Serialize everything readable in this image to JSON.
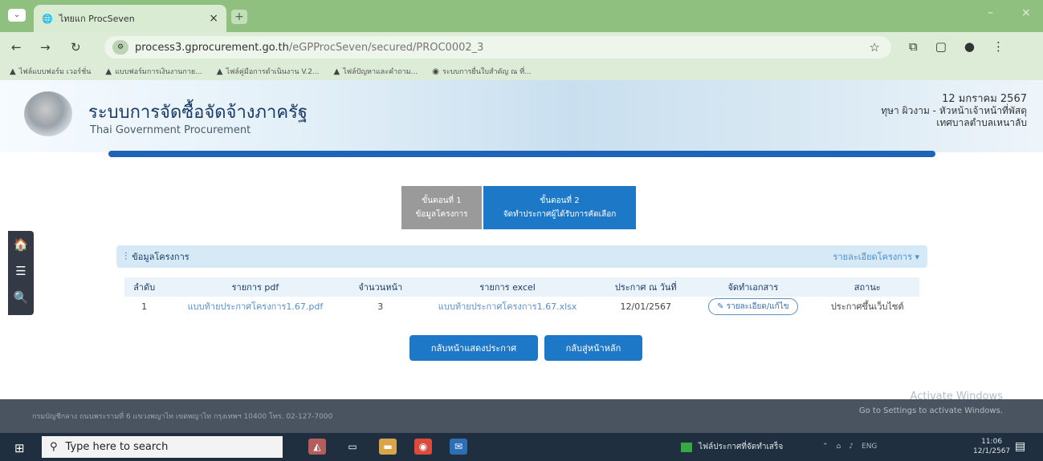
{
  "browser": {
    "tab_title": "ไทยแก ProcSeven",
    "tab_close": "×",
    "newtab": "+",
    "menu_btn": "⌄",
    "url_domain": "process3.gprocurement.go.th",
    "url_path": "/eGPProcSeven/secured/PROC0002_3",
    "bookmarks": [
      "ไฟล์แบบฟอร์ม เวอร์ชั่น",
      "แบบฟอร์มการเงินงานกาย...",
      "ไฟล์คู่มือการดำเนินงาน V.2...",
      "ไฟล์ปัญหาและคำถาม...",
      "ระบบการยื่นใบสำคัญ ณ ที่..."
    ],
    "icons": {
      "back": "←",
      "forward": "→",
      "reload": "↻",
      "star": "☆",
      "min": "–",
      "close": "×"
    }
  },
  "header": {
    "title": "ระบบการจัดซื้อจัดจ้างภาครัฐ",
    "subtitle": "Thai Government Procurement",
    "date": "12 มกราคม 2567",
    "user": "ทุษา ผิวงาม - หัวหน้าเจ้าหน้าที่พัสดุ",
    "org": "เทศบาลตำบลเหนาลับ"
  },
  "sidebar": {
    "home": "🏠",
    "menu": "☰",
    "search": "🔍"
  },
  "steps": [
    {
      "line1": "ขั้นตอนที่ 1",
      "line2": "ข้อมูลโครงการ"
    },
    {
      "line1": "ขั้นตอนที่ 2",
      "line2": "จัดทำประกาศผู้ได้รับการคัดเลือก"
    }
  ],
  "panel": {
    "heading": "ข้อมูลโครงการ",
    "detail_link": "รายละเอียดโครงการ ▾",
    "columns": [
      "ลำดับ",
      "รายการ pdf",
      "จำนวนหน้า",
      "รายการ excel",
      "ประกาศ ณ วันที่",
      "จัดทำเอกสาร",
      "สถานะ"
    ],
    "rows": [
      {
        "no": "1",
        "pdf": "แบบท้ายประกาศโครงการ1.67.pdf",
        "pages": "3",
        "excel": "แบบท้ายประกาศโครงการ1.67.xlsx",
        "date": "12/01/2567",
        "action": "รายละเอียด/แก้ไข",
        "status": "ประกาศขึ้นเว็บไซต์"
      }
    ]
  },
  "buttons": {
    "print": "กลับหน้าแสดงประกาศ",
    "home": "กลับสู่หน้าหลัก"
  },
  "footer": {
    "text": "กรมบัญชีกลาง ถนนพระรามที่ 6 แขวงพญาไท เขตพญาไท กรุงเทพฯ 10400 โทร. 02-127-7000",
    "activate1": "Activate Windows",
    "activate2": "Go to Settings to activate Windows."
  },
  "taskbar": {
    "search_placeholder": "Type here to search",
    "tray_app": "ไฟล์ประกาศที่จัดทำเสร็จ",
    "tray_lang": "ENG",
    "time": "11:06",
    "date": "12/1/2567"
  },
  "colors": {
    "primary": "#1e78c8",
    "header_rule": "#1d63b8",
    "footer": "#4a5460",
    "taskbar": "#1f2f3f"
  }
}
